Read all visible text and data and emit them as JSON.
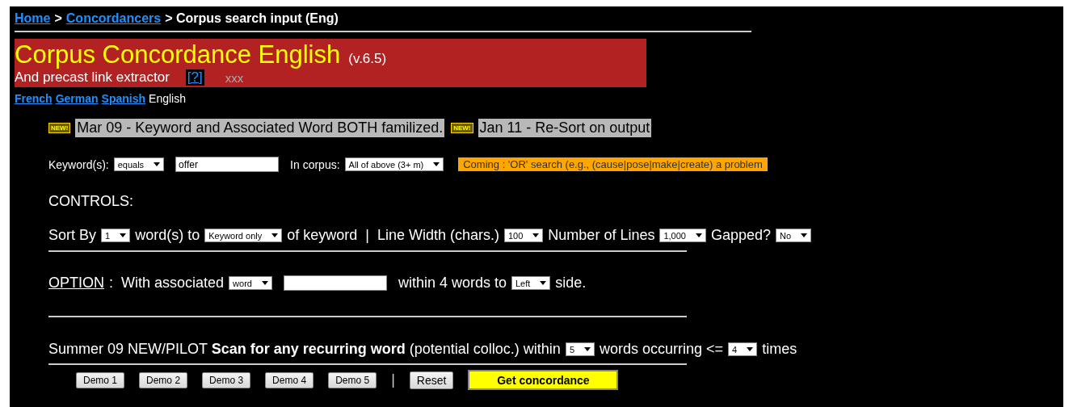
{
  "breadcrumb": [
    {
      "kind": "link",
      "text": "Home"
    },
    {
      "kind": "text",
      "text": ">"
    },
    {
      "kind": "link",
      "text": "Concordancers"
    },
    {
      "kind": "text",
      "text": "> Corpus search input (Eng)"
    }
  ],
  "banner": {
    "title": "Corpus Concordance English",
    "version": "(v.6.5)",
    "subtitle": "And precast link extractor",
    "help": "[?]",
    "note": "xxx"
  },
  "languages": [
    {
      "label": "French",
      "selected": false
    },
    {
      "label": "German",
      "selected": false
    },
    {
      "label": "Spanish",
      "selected": false
    },
    {
      "label": "English",
      "selected": true
    }
  ],
  "news": [
    {
      "badge": "NEW!",
      "text": "Mar 09 - Keyword and Associated Word BOTH familized."
    },
    {
      "badge": "NEW!",
      "text": "Jan 11 - Re-Sort on output"
    }
  ],
  "keyword_row": [
    {
      "kind": "text",
      "text": "Keyword(s):"
    },
    {
      "kind": "select",
      "value": "equals"
    },
    {
      "kind": "input",
      "value": "offer"
    },
    {
      "kind": "text",
      "text": "In corpus:"
    },
    {
      "kind": "select",
      "value": "All of above (3+ m)"
    },
    {
      "kind": "notice",
      "text": "Coming : 'OR' search (e.g., (cause|pose|make|create) a problem"
    }
  ],
  "controls_heading": "CONTROLS:",
  "sort_row": [
    {
      "kind": "text",
      "text": "Sort By"
    },
    {
      "kind": "select",
      "value": "1"
    },
    {
      "kind": "text",
      "text": "word(s) to"
    },
    {
      "kind": "select",
      "value": "Keyword only"
    },
    {
      "kind": "text",
      "text": "of keyword  |  Line Width (chars.)"
    },
    {
      "kind": "select",
      "value": "100"
    },
    {
      "kind": "text",
      "text": "Number of Lines"
    },
    {
      "kind": "select",
      "value": "1,000"
    },
    {
      "kind": "text",
      "text": "Gapped?"
    },
    {
      "kind": "select",
      "value": "No"
    }
  ],
  "option_row": [
    {
      "kind": "label",
      "text": "OPTION"
    },
    {
      "kind": "text",
      "text": ":  With associated"
    },
    {
      "kind": "select",
      "value": "word"
    },
    {
      "kind": "input"
    },
    {
      "kind": "text",
      "text": "within 4 words to"
    },
    {
      "kind": "select",
      "value": "Left"
    },
    {
      "kind": "text",
      "text": "side."
    }
  ],
  "scan_row": [
    {
      "kind": "text",
      "text": "Summer 09 NEW/PILOT **Scan for any recurring word** (potential colloc.) within"
    },
    {
      "kind": "select",
      "value": "5"
    },
    {
      "kind": "text",
      "text": "words occurring <="
    },
    {
      "kind": "select",
      "value": "4"
    },
    {
      "kind": "text",
      "text": "times"
    }
  ],
  "demo_buttons": [
    "Demo 1",
    "Demo 2",
    "Demo 3",
    "Demo 4",
    "Demo 5"
  ],
  "separator": "|",
  "reset_button": "Reset",
  "submit_button": "Get concordance"
}
